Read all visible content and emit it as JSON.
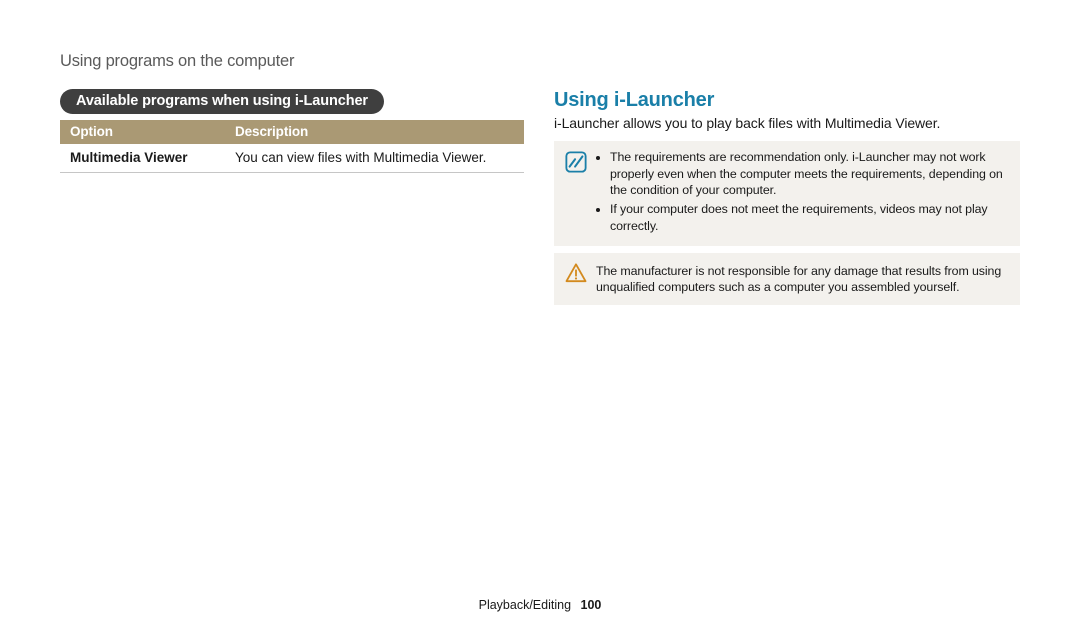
{
  "breadcrumb": "Using programs on the computer",
  "left": {
    "pill": "Available programs when using i-Launcher",
    "table": {
      "head": {
        "option": "Option",
        "desc": "Description"
      },
      "rows": [
        {
          "option": "Multimedia Viewer",
          "desc": "You can view files with Multimedia Viewer."
        }
      ]
    }
  },
  "right": {
    "title": "Using i-Launcher",
    "desc": "i-Launcher allows you to play back files with Multimedia Viewer.",
    "note_items": [
      "The requirements are recommendation only. i-Launcher may not work properly even when the computer meets the requirements, depending on the condition of your computer.",
      "If your computer does not meet the requirements, videos may not play correctly."
    ],
    "warning_text": "The manufacturer is not responsible for any damage that results from using unqualified computers such as a computer you assembled yourself."
  },
  "footer": {
    "section": "Playback/Editing",
    "page": "100"
  }
}
